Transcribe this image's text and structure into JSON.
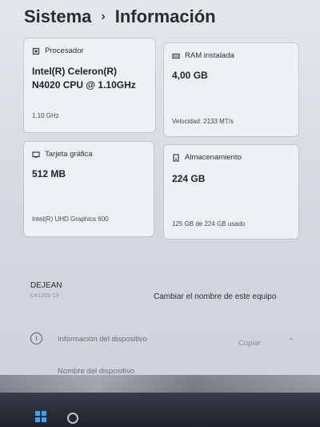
{
  "header": {
    "crumb_root": "Sistema",
    "separator": "›",
    "crumb_current": "Información"
  },
  "specs": {
    "processor": {
      "label": "Procesador",
      "value_line1": "Intel(R) Celeron(R)",
      "value_line2": "N4020 CPU @ 1.10GHz",
      "sub": "1.10 GHz"
    },
    "ram": {
      "label": "RAM instalada",
      "value": "4,00 GB",
      "sub": "Velocidad: 2133 MT/s"
    },
    "gpu": {
      "label": "Tarjeta gráfica",
      "value": "512 MB",
      "sub": "Intel(R) UHD Graphics 600"
    },
    "storage": {
      "label": "Almacenamiento",
      "value": "224 GB",
      "sub": "125 GB de 224 GB usado"
    }
  },
  "device": {
    "name": "DEJEAN",
    "model": "C4120S-13",
    "rename_label": "Cambiar el nombre de este equipo"
  },
  "device_info": {
    "label": "Información del dispositivo",
    "copy_label": "Copiar",
    "chevron": "⌃",
    "row_label": "Nombre del dispositivo"
  },
  "colors": {
    "accent": "#3aa6f2"
  }
}
